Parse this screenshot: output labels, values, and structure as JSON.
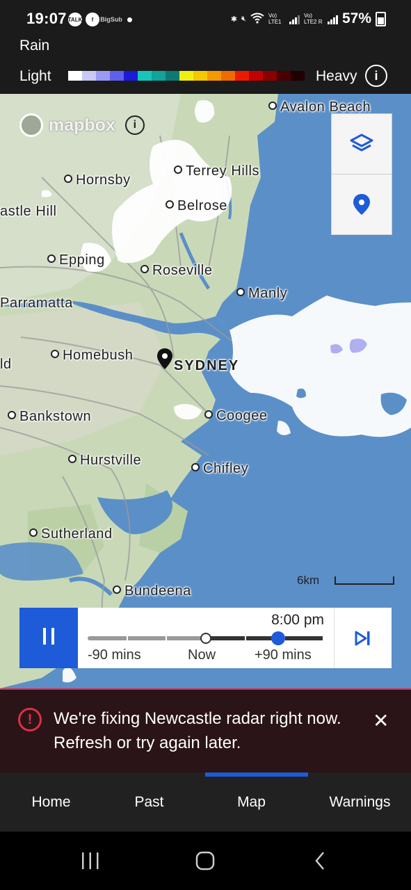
{
  "status_bar": {
    "time": "19:07",
    "notification_icons": [
      "TALK",
      "f",
      "BigSub"
    ],
    "battery_percent": "57%",
    "sim1": "Vo) LTE1",
    "sim2": "Vo) LTE2 R"
  },
  "legend": {
    "title": "Rain",
    "light_label": "Light",
    "heavy_label": "Heavy",
    "info_icon": "ⓘ",
    "scale_colors": [
      "#ffffff",
      "#c8c8f4",
      "#9a9af0",
      "#6060ee",
      "#1a1ad8",
      "#16c6b8",
      "#12a39a",
      "#0e7a74",
      "#f0f010",
      "#f6c800",
      "#f49a00",
      "#f06a00",
      "#ee1a00",
      "#c40000",
      "#8a0000",
      "#4a0000",
      "#200000"
    ]
  },
  "map": {
    "attribution": "mapbox",
    "attribution_info": "i",
    "places": [
      {
        "name": "Avalon Beach"
      },
      {
        "name": "Terrey Hills"
      },
      {
        "name": "Hornsby"
      },
      {
        "name": "Belrose"
      },
      {
        "name": "Castle Hill",
        "display": "astle Hill"
      },
      {
        "name": "Epping"
      },
      {
        "name": "Roseville"
      },
      {
        "name": "Manly"
      },
      {
        "name": "Parramatta"
      },
      {
        "name": "Homebush"
      },
      {
        "name": "SYDNEY"
      },
      {
        "name": "ld"
      },
      {
        "name": "Bankstown"
      },
      {
        "name": "Coogee"
      },
      {
        "name": "Hurstville"
      },
      {
        "name": "Chifley"
      },
      {
        "name": "Sutherland"
      },
      {
        "name": "Bundeena"
      }
    ],
    "scale_label": "6km",
    "layers_button": "layers-icon",
    "location_button": "location-pin-icon"
  },
  "timeline": {
    "current_time": "8:00 pm",
    "start_label": "-90 mins",
    "now_label": "Now",
    "end_label": "+90 mins",
    "play_state": "pause",
    "position_fraction": 0.81
  },
  "alert": {
    "message": "We're fixing Newcastle radar right now. Refresh or try again later.",
    "close": "✕",
    "icon": "!"
  },
  "nav": {
    "items": [
      {
        "label": "Home"
      },
      {
        "label": "Past"
      },
      {
        "label": "Map"
      },
      {
        "label": "Warnings"
      }
    ],
    "active": "Map"
  }
}
